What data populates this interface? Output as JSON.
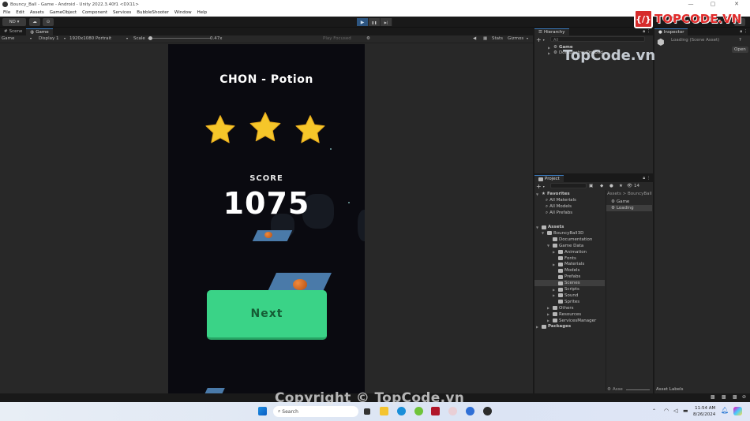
{
  "window": {
    "title": "Bouncy_Ball - Game - Android - Unity 2022.3.40f1 <DX11>",
    "minimize": "—",
    "maximize": "▢",
    "close": "✕"
  },
  "menu": [
    "File",
    "Edit",
    "Assets",
    "GameObject",
    "Component",
    "Services",
    "BubbleShooter",
    "Window",
    "Help"
  ],
  "toolbar": {
    "account": "ND ▾",
    "cloud_icon": "☁",
    "history_icon": "⊙",
    "play": "▶",
    "pause": "❚❚",
    "step": "▶|"
  },
  "game_panel": {
    "tabs": [
      {
        "label": "Scene",
        "icon": "#"
      },
      {
        "label": "Game",
        "icon": "◍",
        "active": true
      }
    ],
    "display_mode": "Game",
    "display": "Display 1",
    "resolution": "1920x1080 Portrait",
    "scale_label": "Scale",
    "scale_value": "0.47x",
    "play_mode": "Play Focused",
    "stats": "Stats",
    "gizmos": "Gizmos"
  },
  "game": {
    "level_title": "CHON - Potion",
    "stars_earned": 3,
    "stars_total": 3,
    "score_label": "SCORE",
    "score_value": "1075",
    "next_button": "Next",
    "colors": {
      "button": "#3ad387",
      "button_text": "#155c35",
      "star": "#f5c62a",
      "platform": "#4a7aa9"
    }
  },
  "hierarchy": {
    "tab": "Hierarchy",
    "search_placeholder": "All",
    "items": [
      {
        "label": "Game"
      },
      {
        "label": "DontDestroyOnLoad"
      }
    ]
  },
  "inspector": {
    "tab": "Inspector",
    "object": "Loading (Scene Asset)",
    "open_button": "Open",
    "footer": "Asset Labels"
  },
  "project": {
    "tab": "Project",
    "hidden_count": "14",
    "breadcrumb": "Assets > BouncyBall",
    "favorites": {
      "label": "Favorites",
      "items": [
        "All Materials",
        "All Models",
        "All Prefabs"
      ]
    },
    "tree": [
      {
        "label": "Assets",
        "depth": 0
      },
      {
        "label": "BouncyBall3D",
        "depth": 1
      },
      {
        "label": "Documentation",
        "depth": 2
      },
      {
        "label": "Game Data",
        "depth": 2
      },
      {
        "label": "Animation",
        "depth": 3
      },
      {
        "label": "Fonts",
        "depth": 3
      },
      {
        "label": "Materials",
        "depth": 3
      },
      {
        "label": "Models",
        "depth": 3
      },
      {
        "label": "Prefabs",
        "depth": 3
      },
      {
        "label": "Scenes",
        "depth": 3,
        "selected": true
      },
      {
        "label": "Scripts",
        "depth": 3
      },
      {
        "label": "Sound",
        "depth": 3
      },
      {
        "label": "Sprites",
        "depth": 3
      },
      {
        "label": "Others",
        "depth": 2
      },
      {
        "label": "Resources",
        "depth": 2
      },
      {
        "label": "ServicesManager",
        "depth": 2
      },
      {
        "label": "Packages",
        "depth": 0
      }
    ],
    "assets": [
      {
        "label": "Game"
      },
      {
        "label": "Loading",
        "selected": true
      }
    ],
    "footer_label": "Asse"
  },
  "taskbar": {
    "search_placeholder": "Search",
    "time": "11:54 AM",
    "date": "8/26/2024"
  },
  "watermarks": {
    "copyright": "Copyright © TopCode.vn",
    "site": "TopCode.vn",
    "logo_text": "TOPCODE.VN",
    "logo_mark": "{/}"
  }
}
